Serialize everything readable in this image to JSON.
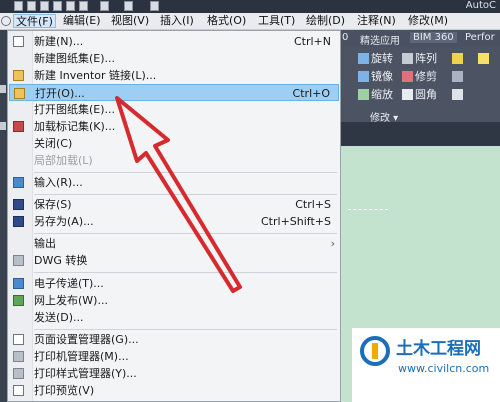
{
  "app": {
    "title": "AutoC"
  },
  "menubar": {
    "items": [
      "文件(F)",
      "编辑(E)",
      "视图(V)",
      "插入(I)",
      "格式(O)",
      "工具(T)",
      "绘制(D)",
      "注释(N)",
      "修改(M)"
    ]
  },
  "ribbon": {
    "tabs": [
      "0",
      "精选应用",
      "BIM 360",
      "Perfor"
    ],
    "buttons": {
      "rotate": "旋转",
      "array": "阵列",
      "mirror": "镜像",
      "trim": "修剪",
      "scale": "缩放",
      "fillet": "圆角"
    },
    "panel_label": "修改 ▾"
  },
  "file_menu": {
    "items": [
      {
        "label": "新建(N)...",
        "shortcut": "Ctrl+N",
        "icon": "new-doc-icon"
      },
      {
        "label": "新建图纸集(E)...",
        "shortcut": "",
        "icon": ""
      },
      {
        "label": "新建 Inventor 链接(L)...",
        "shortcut": "",
        "icon": "inventor-link-icon"
      },
      {
        "label": "打开(O)...",
        "shortcut": "Ctrl+O",
        "icon": "open-folder-icon",
        "highlighted": true
      },
      {
        "label": "打开图纸集(E)...",
        "shortcut": "",
        "icon": ""
      },
      {
        "label": "加载标记集(K)...",
        "shortcut": "",
        "icon": "markup-icon"
      },
      {
        "label": "关闭(C)",
        "shortcut": "",
        "icon": ""
      },
      {
        "label": "局部加载(L)",
        "shortcut": "",
        "icon": "",
        "disabled": true
      },
      {
        "label": "输入(R)...",
        "shortcut": "",
        "icon": "import-icon"
      },
      {
        "label": "保存(S)",
        "shortcut": "Ctrl+S",
        "icon": "save-icon"
      },
      {
        "label": "另存为(A)...",
        "shortcut": "Ctrl+Shift+S",
        "icon": "save-as-icon"
      },
      {
        "label": "输出",
        "shortcut": "",
        "icon": "",
        "submenu": true
      },
      {
        "label": "DWG 转换",
        "shortcut": "",
        "icon": "dwg-convert-icon"
      },
      {
        "label": "电子传递(T)...",
        "shortcut": "",
        "icon": "etransmit-icon"
      },
      {
        "label": "网上发布(W)...",
        "shortcut": "",
        "icon": "publish-web-icon"
      },
      {
        "label": "发送(D)...",
        "shortcut": "",
        "icon": ""
      },
      {
        "label": "页面设置管理器(G)...",
        "shortcut": "",
        "icon": "page-setup-icon"
      },
      {
        "label": "打印机管理器(M)...",
        "shortcut": "",
        "icon": "plotter-manager-icon"
      },
      {
        "label": "打印样式管理器(Y)...",
        "shortcut": "",
        "icon": "plot-style-icon"
      },
      {
        "label": "打印预览(V)",
        "shortcut": "",
        "icon": "plot-preview-icon"
      }
    ],
    "submenu_arrow": "›"
  },
  "watermark": {
    "name": "土木工程网",
    "url": "www.civilcn.com"
  },
  "colors": {
    "highlight": "#9ccff3",
    "arrow": "#d62a2f",
    "canvas": "#c4e3cf"
  }
}
